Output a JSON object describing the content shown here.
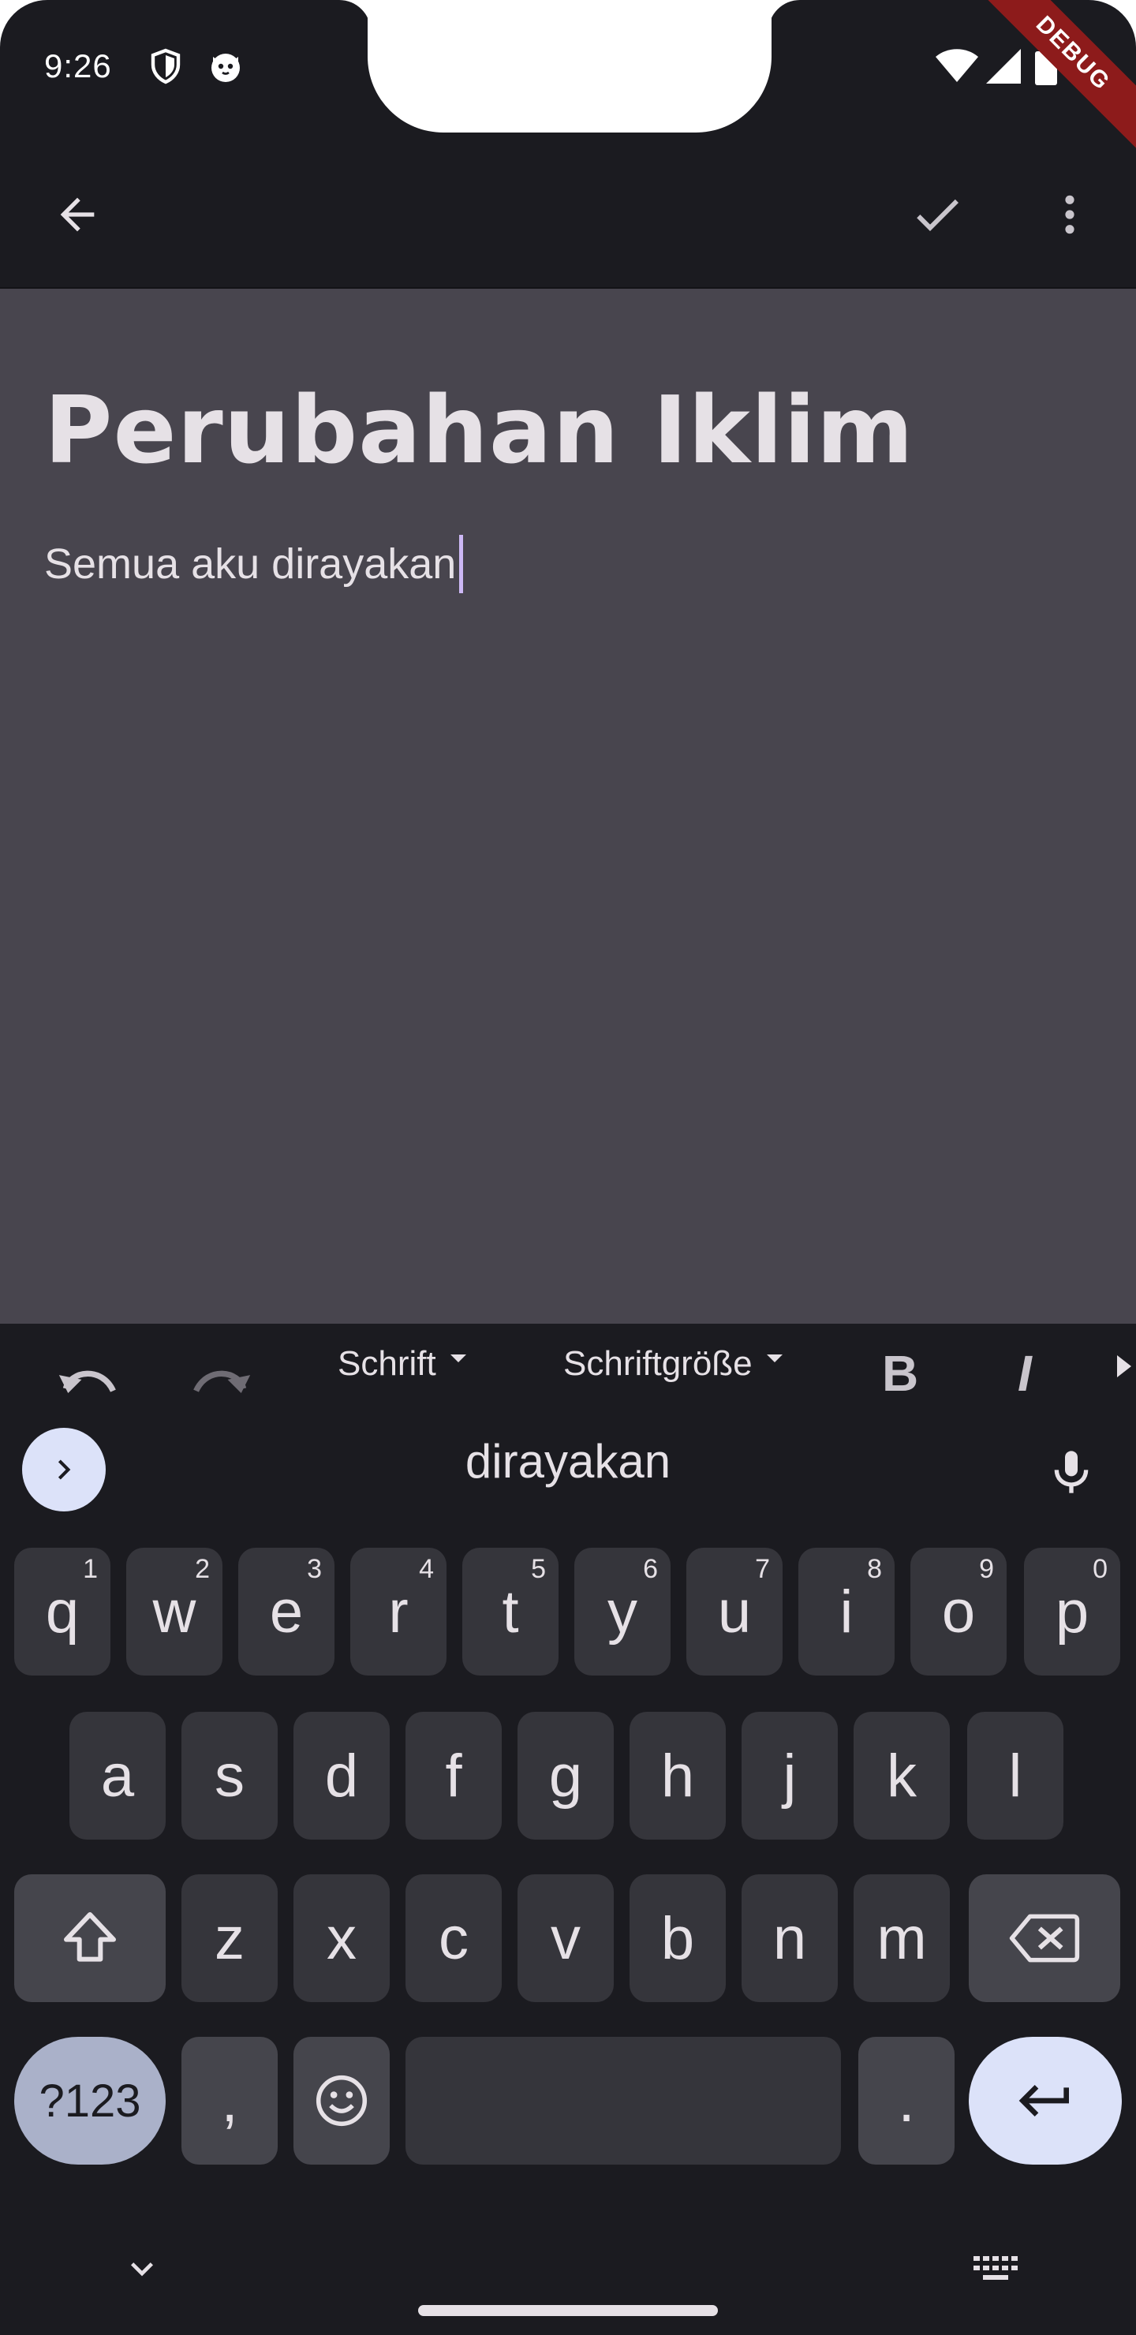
{
  "status_bar": {
    "time": "9:26",
    "debug_label": "DEBUG"
  },
  "app_bar": {
    "icons": [
      "arrow-back-icon",
      "check-icon",
      "more-vert-icon"
    ]
  },
  "note": {
    "title": "Perubahan Iklim",
    "body": "Semua aku dirayakan"
  },
  "format_toolbar": {
    "font_label": "Schrift",
    "font_size_label": "Schriftgröße",
    "bold_label": "B",
    "italic_label": "I"
  },
  "keyboard": {
    "suggestion": "dirayakan",
    "row1": [
      {
        "key": "q",
        "hint": "1"
      },
      {
        "key": "w",
        "hint": "2"
      },
      {
        "key": "e",
        "hint": "3"
      },
      {
        "key": "r",
        "hint": "4"
      },
      {
        "key": "t",
        "hint": "5"
      },
      {
        "key": "y",
        "hint": "6"
      },
      {
        "key": "u",
        "hint": "7"
      },
      {
        "key": "i",
        "hint": "8"
      },
      {
        "key": "o",
        "hint": "9"
      },
      {
        "key": "p",
        "hint": "0"
      }
    ],
    "row2": [
      "a",
      "s",
      "d",
      "f",
      "g",
      "h",
      "j",
      "k",
      "l"
    ],
    "row3": [
      "z",
      "x",
      "c",
      "v",
      "b",
      "n",
      "m"
    ],
    "symbols_label": "?123",
    "comma": ",",
    "period": "."
  },
  "colors": {
    "background": "#1b1b20",
    "editor": "#48454e",
    "key": "#35353b",
    "accent_key": "#dce2f9",
    "caret": "#cdb8f5"
  }
}
